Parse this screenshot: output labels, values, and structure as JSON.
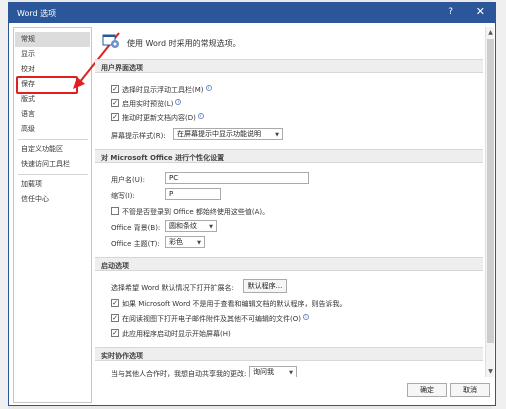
{
  "window": {
    "title": "Word 选项",
    "help": "?",
    "close": "✕"
  },
  "sidebar": {
    "items": [
      {
        "label": "常规"
      },
      {
        "label": "显示"
      },
      {
        "label": "校对"
      },
      {
        "label": "保存"
      },
      {
        "label": "版式"
      },
      {
        "label": "语言"
      },
      {
        "label": "高级"
      },
      {
        "label": "自定义功能区"
      },
      {
        "label": "快速访问工具栏"
      },
      {
        "label": "加载项"
      },
      {
        "label": "信任中心"
      }
    ],
    "active_index": 0,
    "highlighted_index": 3
  },
  "general": {
    "header": "使用 Word 时采用的常规选项。",
    "ui_section": "用户界面选项",
    "ui_options": [
      {
        "label": "选择时显示浮动工具栏(M)",
        "checked": true
      },
      {
        "label": "启用实时预览(L)",
        "checked": true
      },
      {
        "label": "拖动时更新文档内容(D)",
        "checked": true
      }
    ],
    "screentip_label": "屏幕提示样式(R):",
    "screentip_value": "在屏幕提示中显示功能说明",
    "personalize_section": "对 Microsoft Office 进行个性化设置",
    "username_label": "用户名(U):",
    "username_value": "PC",
    "initials_label": "缩写(I):",
    "initials_value": "P",
    "always_use_label": "不管是否登录到 Office 都始终使用这些值(A)。",
    "always_use_checked": false,
    "background_label": "Office 背景(B):",
    "background_value": "圆和条纹",
    "theme_label": "Office 主题(T):",
    "theme_value": "彩色",
    "startup_section": "启动选项",
    "default_programs_label": "选择希望 Word 默认情况下打开扩展名:",
    "default_programs_button": "默认程序...",
    "startup_options": [
      {
        "label": "如果 Microsoft Word 不是用于查看和编辑文档的默认程序，则告诉我。",
        "checked": true
      },
      {
        "label": "在阅读视图下打开电子邮件附件及其他不可编辑的文件(O)",
        "checked": true
      },
      {
        "label": "此应用程序启动时显示开始屏幕(H)",
        "checked": true
      }
    ],
    "realtime_section": "实时协作选项",
    "realtime_label": "当与其他人合作时，我想自动共享我的更改:",
    "realtime_value": "询问我"
  },
  "footer": {
    "ok": "确定",
    "cancel": "取消"
  },
  "colors": {
    "accent": "#2b579a",
    "highlight": "#e02020"
  }
}
